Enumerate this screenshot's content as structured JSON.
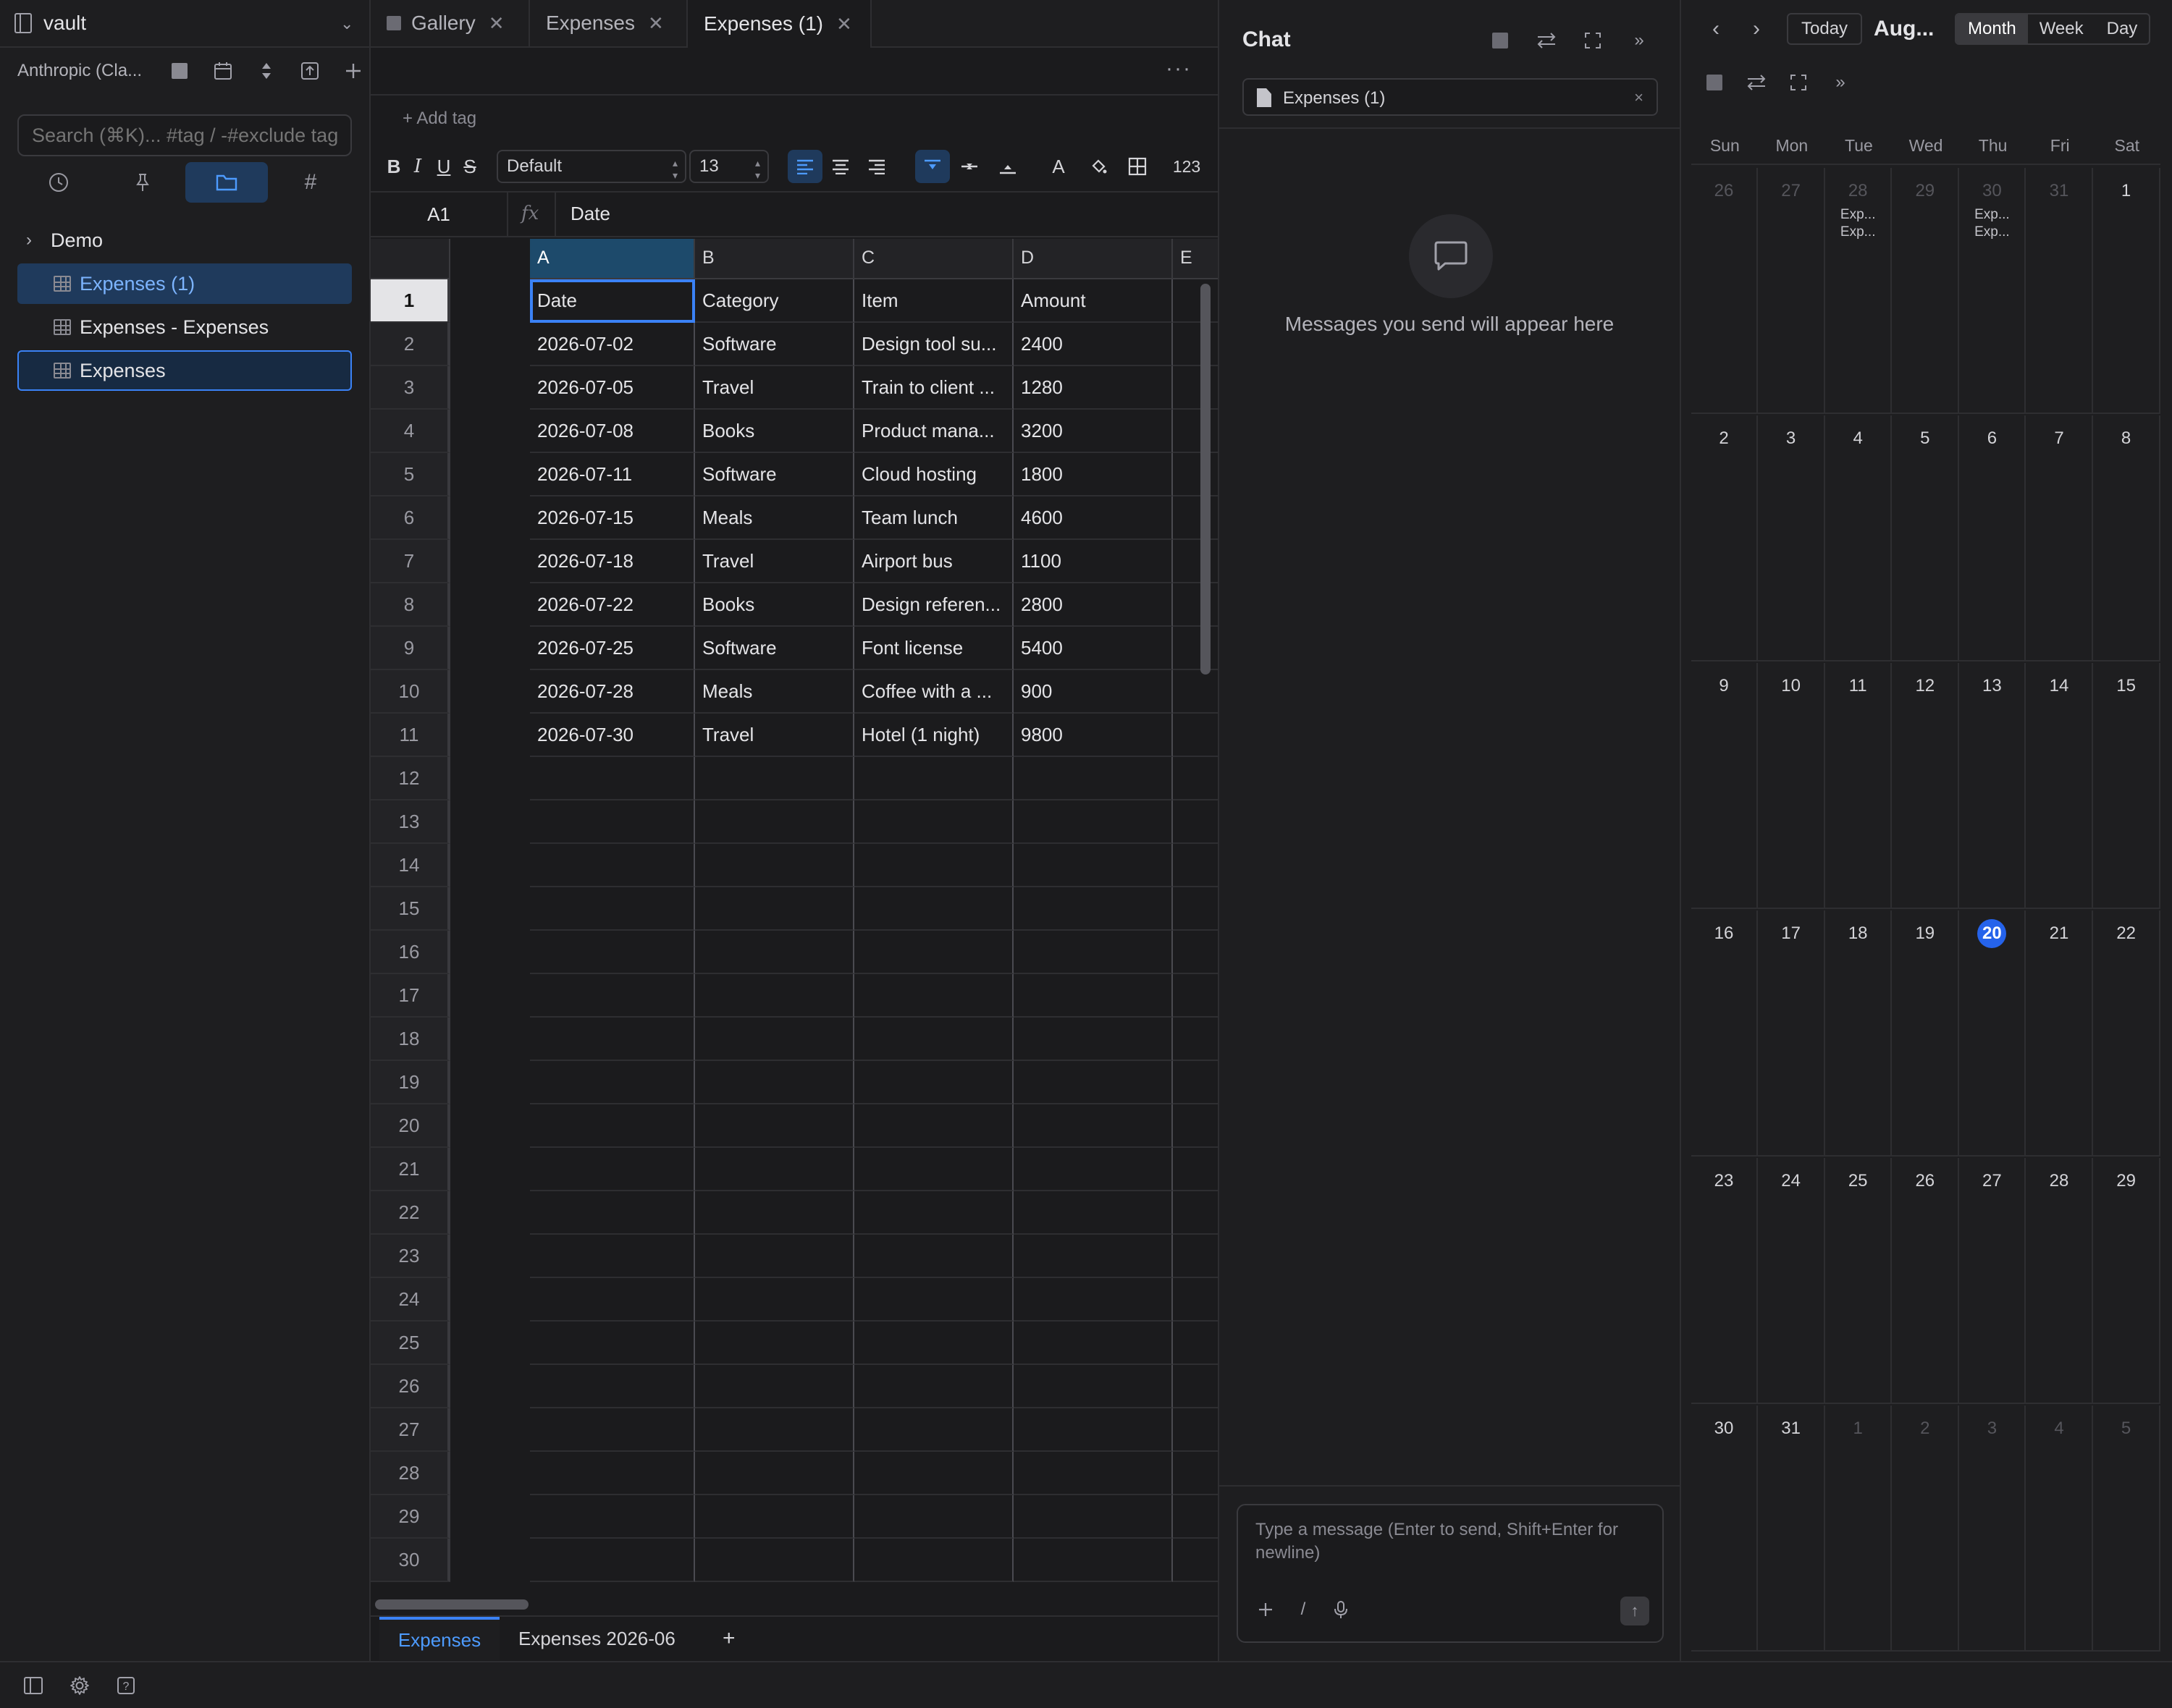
{
  "sidebar": {
    "vault_name": "vault",
    "model_name": "Anthropic (Cla...",
    "search_placeholder": "Search (⌘K)... #tag / -#exclude tag",
    "tree": {
      "folder": "Demo",
      "items": [
        "Expenses (1)",
        "Expenses - Expenses",
        "Expenses"
      ]
    }
  },
  "tabs": [
    {
      "label": "Gallery"
    },
    {
      "label": "Expenses"
    },
    {
      "label": "Expenses (1)"
    }
  ],
  "editor": {
    "add_tag": "+ Add tag",
    "font_name": "Default",
    "font_size": "13",
    "number_format": "123",
    "cell_ref": "A1",
    "formula_value": "Date",
    "columns": [
      "A",
      "B",
      "C",
      "D",
      "E"
    ],
    "rows": [
      [
        "Date",
        "Category",
        "Item",
        "Amount",
        ""
      ],
      [
        "2026-07-02",
        "Software",
        "Design tool su...",
        "2400",
        ""
      ],
      [
        "2026-07-05",
        "Travel",
        "Train to client ...",
        "1280",
        ""
      ],
      [
        "2026-07-08",
        "Books",
        "Product mana...",
        "3200",
        ""
      ],
      [
        "2026-07-11",
        "Software",
        "Cloud hosting",
        "1800",
        ""
      ],
      [
        "2026-07-15",
        "Meals",
        "Team lunch",
        "4600",
        ""
      ],
      [
        "2026-07-18",
        "Travel",
        "Airport bus",
        "1100",
        ""
      ],
      [
        "2026-07-22",
        "Books",
        "Design referen...",
        "2800",
        ""
      ],
      [
        "2026-07-25",
        "Software",
        "Font license",
        "5400",
        ""
      ],
      [
        "2026-07-28",
        "Meals",
        "Coffee with a ...",
        "900",
        ""
      ],
      [
        "2026-07-30",
        "Travel",
        "Hotel (1 night)",
        "9800",
        ""
      ]
    ],
    "visible_row_count": 30,
    "sheets": [
      "Expenses",
      "Expenses 2026-06"
    ]
  },
  "chat": {
    "title": "Chat",
    "context_doc": "Expenses (1)",
    "empty_message": "Messages you send will appear here",
    "input_placeholder": "Type a message (Enter to send, Shift+Enter for newline)"
  },
  "calendar": {
    "today_label": "Today",
    "month_label": "Aug...",
    "views": [
      "Month",
      "Week",
      "Day"
    ],
    "active_view": "Month",
    "weekdays": [
      "Sun",
      "Mon",
      "Tue",
      "Wed",
      "Thu",
      "Fri",
      "Sat"
    ],
    "weeks": [
      [
        {
          "d": "26",
          "o": true
        },
        {
          "d": "27",
          "o": true
        },
        {
          "d": "28",
          "o": true,
          "ev": [
            "Exp...",
            "Exp..."
          ]
        },
        {
          "d": "29",
          "o": true
        },
        {
          "d": "30",
          "o": true,
          "ev": [
            "Exp...",
            "Exp..."
          ]
        },
        {
          "d": "31",
          "o": true
        },
        {
          "d": "1"
        }
      ],
      [
        {
          "d": "2"
        },
        {
          "d": "3"
        },
        {
          "d": "4"
        },
        {
          "d": "5"
        },
        {
          "d": "6"
        },
        {
          "d": "7"
        },
        {
          "d": "8"
        }
      ],
      [
        {
          "d": "9"
        },
        {
          "d": "10"
        },
        {
          "d": "11"
        },
        {
          "d": "12"
        },
        {
          "d": "13"
        },
        {
          "d": "14"
        },
        {
          "d": "15"
        }
      ],
      [
        {
          "d": "16"
        },
        {
          "d": "17"
        },
        {
          "d": "18"
        },
        {
          "d": "19"
        },
        {
          "d": "20",
          "today": true
        },
        {
          "d": "21"
        },
        {
          "d": "22"
        }
      ],
      [
        {
          "d": "23"
        },
        {
          "d": "24"
        },
        {
          "d": "25"
        },
        {
          "d": "26"
        },
        {
          "d": "27"
        },
        {
          "d": "28"
        },
        {
          "d": "29"
        }
      ],
      [
        {
          "d": "30"
        },
        {
          "d": "31"
        },
        {
          "d": "1",
          "o": true
        },
        {
          "d": "2",
          "o": true
        },
        {
          "d": "3",
          "o": true
        },
        {
          "d": "4",
          "o": true
        },
        {
          "d": "5",
          "o": true
        }
      ]
    ]
  },
  "colors": {
    "accent": "#3b82f6",
    "background": "#1b1b1d",
    "panel": "#1e1e20",
    "selection": "#1f3a5c"
  }
}
